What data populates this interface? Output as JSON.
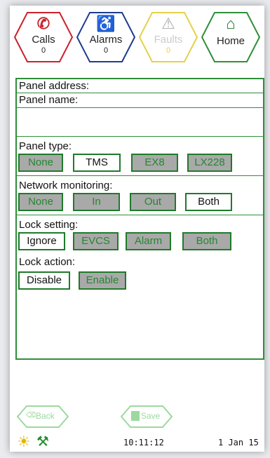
{
  "nav": {
    "calls": {
      "label": "Calls",
      "count": "0",
      "color": "#c8232c"
    },
    "alarms": {
      "label": "Alarms",
      "count": "0",
      "color": "#1f3b8f"
    },
    "faults": {
      "label": "Faults",
      "count": "0",
      "color": "#e5d14a"
    },
    "home": {
      "label": "Home",
      "color": "#2f8f3a"
    }
  },
  "fields": {
    "address_label": "Panel address:",
    "name_label": "Panel name:"
  },
  "panel_type": {
    "label": "Panel type:",
    "options": [
      "None",
      "TMS",
      "EX8",
      "LX228"
    ],
    "selected": "TMS"
  },
  "network": {
    "label": "Network monitoring:",
    "options": [
      "None",
      "In",
      "Out",
      "Both"
    ],
    "selected": "Both"
  },
  "lock_setting": {
    "label": "Lock setting:",
    "options": [
      "Ignore",
      "EVCS",
      "Alarm",
      "Both"
    ],
    "selected": "Ignore"
  },
  "lock_action": {
    "label": "Lock action:",
    "options": [
      "Disable",
      "Enable"
    ],
    "selected": "Disable"
  },
  "footer": {
    "back_label": "Back",
    "save_label": "Save",
    "time": "10:11:12",
    "date": "1 Jan 15"
  },
  "colors": {
    "accent": "#2f8f3a",
    "button_grey": "#a9a9a9"
  }
}
